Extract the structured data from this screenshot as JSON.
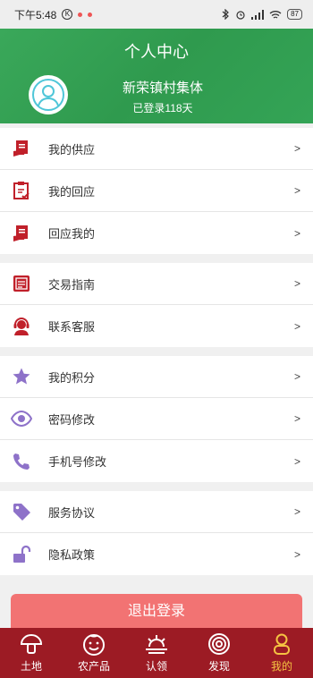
{
  "status": {
    "time": "下午5:48",
    "k_label": "K",
    "battery": "87"
  },
  "header": {
    "title": "个人中心",
    "user_name": "新荣镇村集体",
    "login_days": "已登录118天"
  },
  "menu": {
    "groups": [
      [
        {
          "label": "我的供应",
          "icon": "supply-icon",
          "arrow": ">"
        },
        {
          "label": "我的回应",
          "icon": "clipboard-check-icon",
          "arrow": ">"
        },
        {
          "label": "回应我的",
          "icon": "document-icon",
          "arrow": ">"
        }
      ],
      [
        {
          "label": "交易指南",
          "icon": "guide-icon",
          "arrow": ">"
        },
        {
          "label": "联系客服",
          "icon": "headset-icon",
          "arrow": ">"
        }
      ],
      [
        {
          "label": "我的积分",
          "icon": "star-icon",
          "arrow": ">"
        },
        {
          "label": "密码修改",
          "icon": "eye-icon",
          "arrow": ">"
        },
        {
          "label": "手机号修改",
          "icon": "phone-icon",
          "arrow": ">"
        }
      ],
      [
        {
          "label": "服务协议",
          "icon": "tag-icon",
          "arrow": ">"
        },
        {
          "label": "隐私政策",
          "icon": "unlock-icon",
          "arrow": ">"
        }
      ]
    ]
  },
  "logout_label": "退出登录",
  "tabs": [
    {
      "label": "土地",
      "icon": "mushroom-icon"
    },
    {
      "label": "农产品",
      "icon": "smile-icon"
    },
    {
      "label": "认领",
      "icon": "sunrise-icon"
    },
    {
      "label": "发现",
      "icon": "target-icon"
    },
    {
      "label": "我的",
      "icon": "person-icon",
      "active": true
    }
  ],
  "colors": {
    "header": "#34a456",
    "menu_red": "#c0202a",
    "menu_purple": "#8e72c9",
    "tabbar": "#9c1b24",
    "tab_active": "#f5c342",
    "logout": "#f27373"
  }
}
